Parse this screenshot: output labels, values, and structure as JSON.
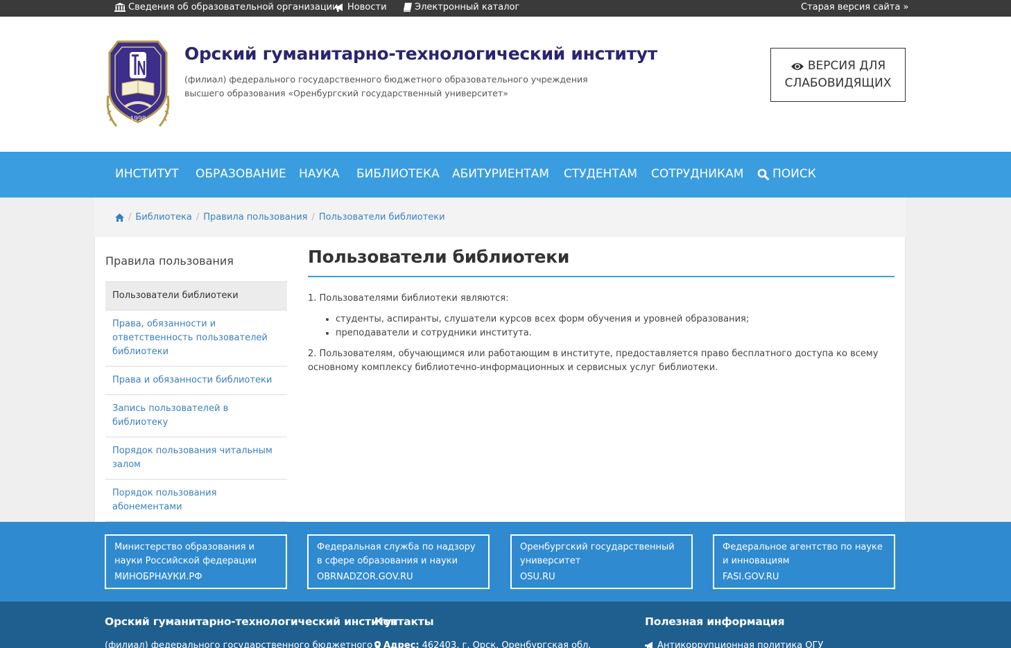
{
  "topbar": {
    "org_info": "Сведения об образовательной организации",
    "news": "Новости",
    "catalog": "Электронный каталог",
    "old_version": "Старая версия сайта »"
  },
  "header": {
    "logo_year": "1998",
    "title": "Орский гуманитарно-технологический институт",
    "subtitle": "(филиал) федерального государственного бюджетного образовательного учреждения высшего образования «Оренбургский государственный университет»",
    "vision_line1": "ВЕРСИЯ ДЛЯ",
    "vision_line2": "СЛАБОВИДЯЩИХ"
  },
  "nav": {
    "items": [
      "ИНСТИТУТ",
      "ОБРАЗОВАНИЕ",
      "НАУКА",
      "БИБЛИОТЕКА",
      "АБИТУРИЕНТАМ",
      "СТУДЕНТАМ",
      "СОТРУДНИКАМ"
    ],
    "search": "ПОИСК"
  },
  "breadcrumb": {
    "items": [
      "Библиотека",
      "Правила пользования",
      "Пользователи библиотеки"
    ]
  },
  "sidebar": {
    "title": "Правила пользования",
    "items": [
      "Пользователи библиотеки",
      "Права, обязанности и ответственность пользователей библиотеки",
      "Права и обязанности библиотеки",
      "Запись пользователей в библиотеку",
      "Порядок пользования читальным залом",
      "Порядок пользования абонементами"
    ]
  },
  "content": {
    "title": "Пользователи библиотеки",
    "p1": "1. Пользователями библиотеки являются:",
    "bullets": [
      "студенты, аспиранты, слушатели курсов всех форм обучения и уровней образования;",
      "преподаватели и сотрудники института."
    ],
    "p2": "2. Пользователям, обучающимся или работающим в институте, предоставляется право бесплатного доступа ко всему основному комплексу библиотечно-информационных и сервисных услуг библиотеки."
  },
  "partners": [
    {
      "desc": "Министерство образования и науки Российской федерации",
      "link": "МИНОБРНАУКИ.РФ"
    },
    {
      "desc": "Федеральная служба по надзору в сфере образования и науки",
      "link": "OBRNADZOR.GOV.RU"
    },
    {
      "desc": "Оренбургский государственный университет",
      "link": "OSU.RU"
    },
    {
      "desc": "Федеральное агентство по науке и инновациям",
      "link": "FASI.GOV.RU"
    }
  ],
  "footer": {
    "col1_title": "Орский гуманитарно-технологический институт",
    "col1_text": "(филиал) федерального государственного бюджетного",
    "col2_title": "Контакты",
    "col2_label": "Адрес:",
    "col2_text": "462403, г. Орск, Оренбургская обл.",
    "col3_title": "Полезная информация",
    "col3_text": "Антикоррупционная политика ОГУ"
  },
  "colors": {
    "nav": "#3a9de0",
    "title": "#2a2470",
    "link": "#3a7fc0",
    "partners_bg": "#2f8ad0",
    "footer_bg": "#1f5f8f"
  }
}
